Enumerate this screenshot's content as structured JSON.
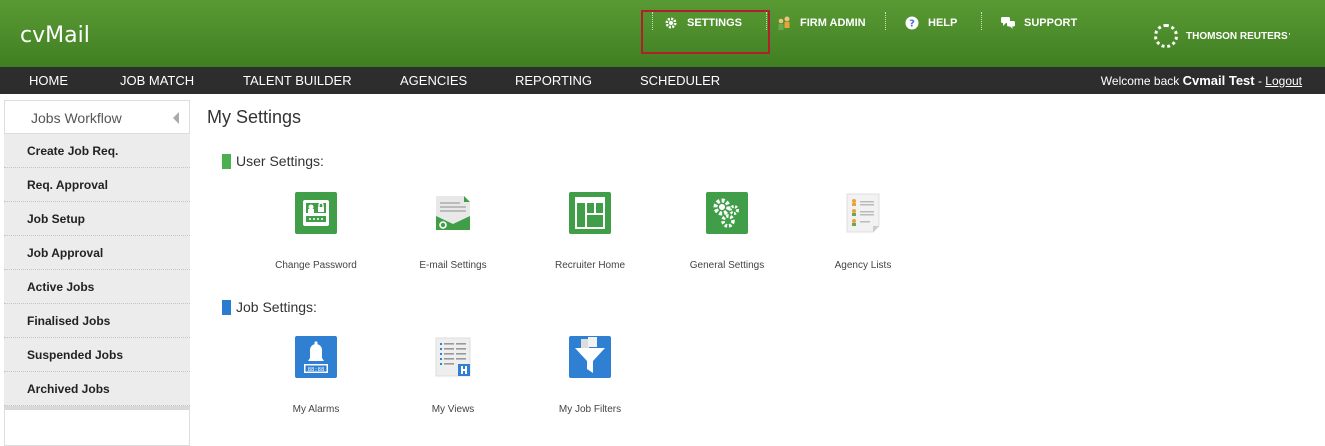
{
  "header": {
    "logo": "cvMail",
    "links": [
      {
        "label": "SETTINGS"
      },
      {
        "label": "FIRM ADMIN"
      },
      {
        "label": "HELP"
      },
      {
        "label": "SUPPORT"
      }
    ],
    "brand": "THOMSON REUTERS",
    "brand_mark": "'",
    "highlight_color": "#b0202a"
  },
  "nav": {
    "items": [
      "HOME",
      "JOB MATCH",
      "TALENT BUILDER",
      "AGENCIES",
      "REPORTING",
      "SCHEDULER"
    ],
    "welcome_prefix": "Welcome back ",
    "user": "Cvmail Test",
    "separator": " - ",
    "logout": "Logout"
  },
  "sidebar": {
    "title": "Jobs Workflow",
    "items": [
      "Create Job Req.",
      "Req. Approval",
      "Job Setup",
      "Job Approval",
      "Active Jobs",
      "Finalised Jobs",
      "Suspended Jobs",
      "Archived Jobs"
    ]
  },
  "main": {
    "title": "My Settings",
    "user_settings": {
      "heading": "User Settings:",
      "color": "#4caf50",
      "tiles": [
        "Change Password",
        "E-mail Settings",
        "Recruiter Home",
        "General Settings",
        "Agency Lists"
      ]
    },
    "job_settings": {
      "heading": "Job Settings:",
      "color": "#2b7bd1",
      "tiles": [
        "My Alarms",
        "My Views",
        "My Job Filters"
      ]
    }
  },
  "colors": {
    "header_green": "#4f8f2c",
    "nav_dark": "#2d2d2d",
    "tile_green": "#3f9e47",
    "tile_blue": "#2f7fd3"
  }
}
